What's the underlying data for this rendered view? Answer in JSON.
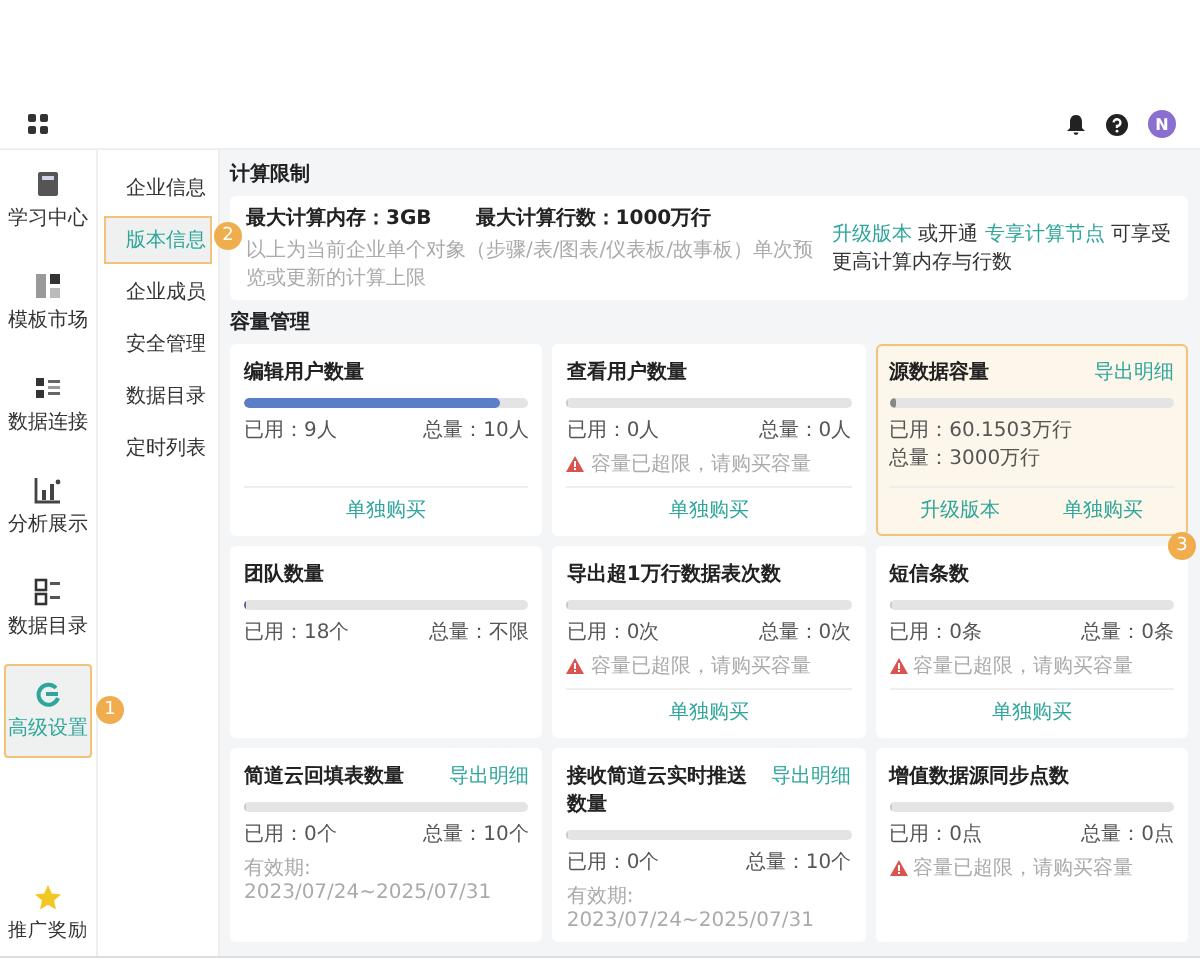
{
  "topbar": {
    "avatar": "N"
  },
  "rail": {
    "items": [
      {
        "label": "学习中心",
        "selected": false,
        "highlighted": false
      },
      {
        "label": "模板市场",
        "selected": false,
        "highlighted": false
      },
      {
        "label": "数据连接",
        "selected": false,
        "highlighted": false
      },
      {
        "label": "分析展示",
        "selected": false,
        "highlighted": false
      },
      {
        "label": "数据目录",
        "selected": false,
        "highlighted": false
      },
      {
        "label": "高级设置",
        "selected": true,
        "highlighted": true,
        "callout": "1"
      }
    ],
    "bottom": {
      "label": "推广奖励"
    }
  },
  "submenu": {
    "items": [
      {
        "label": "企业信息",
        "selected": false,
        "highlighted": false
      },
      {
        "label": "版本信息",
        "selected": true,
        "highlighted": true,
        "callout": "2"
      },
      {
        "label": "企业成员",
        "selected": false,
        "highlighted": false
      },
      {
        "label": "安全管理",
        "selected": false,
        "highlighted": false
      },
      {
        "label": "数据目录",
        "selected": false,
        "highlighted": false
      },
      {
        "label": "定时列表",
        "selected": false,
        "highlighted": false
      }
    ]
  },
  "compute_limits": {
    "title": "计算限制",
    "max_memory": "最大计算内存：3GB",
    "max_rows": "最大计算行数：1000万行",
    "hint": "以上为当前企业单个对象（步骤/表/图表/仪表板/故事板）单次预览或更新的计算上限",
    "upgrade_note": [
      {
        "kind": "link",
        "text": "升级版本"
      },
      {
        "kind": "text",
        "text": "或开通"
      },
      {
        "kind": "link",
        "text": "专享计算节点"
      },
      {
        "kind": "text",
        "text": "可享受更高计算内存与行数"
      }
    ]
  },
  "capacity": {
    "title": "容量管理",
    "cards": [
      {
        "title": "编辑用户数量",
        "level": 0.9,
        "color": "#5b7fc7",
        "used": "已用：9人",
        "total": "总量：10人",
        "actions": [
          "单独购买"
        ],
        "highlighted": false
      },
      {
        "title": "查看用户数量",
        "level": 0,
        "used": "已用：0人",
        "total": "总量：0人",
        "warning": "容量已超限，请购买容量",
        "actions": [
          "单独购买"
        ],
        "highlighted": false
      },
      {
        "title": "源数据容量",
        "export": "导出明细",
        "level": 0.02,
        "color": "#888888",
        "used": "已用：60.1503万行",
        "total": "总量：3000万行",
        "actions": [
          "升级版本",
          "单独购买"
        ],
        "highlighted": true,
        "callout": "3"
      },
      {
        "title": "团队数量",
        "level": 0.01,
        "color": "#6a5a9a",
        "used": "已用：18个",
        "total": "总量：不限",
        "highlighted": false
      },
      {
        "title": "导出超1万行数据表次数",
        "level": 0,
        "used": "已用：0次",
        "total": "总量：0次",
        "warning": "容量已超限，请购买容量",
        "actions": [
          "单独购买"
        ],
        "highlighted": false
      },
      {
        "title": "短信条数",
        "level": 0,
        "used": "已用：0条",
        "total": "总量：0条",
        "warning": "容量已超限，请购买容量",
        "actions": [
          "单独购买"
        ],
        "highlighted": false
      },
      {
        "title": "简道云回填表数量",
        "export": "导出明细",
        "level": 0,
        "used": "已用：0个",
        "total": "总量：10个",
        "validity": "有效期: 2023/07/24~2025/07/31",
        "highlighted": false
      },
      {
        "title": "接收简道云实时推送数量",
        "export": "导出明细",
        "level": 0,
        "used": "已用：0个",
        "total": "总量：10个",
        "validity": "有效期: 2023/07/24~2025/07/31",
        "highlighted": false
      },
      {
        "title": "增值数据源同步点数",
        "level": 0,
        "used": "已用：0点",
        "total": "总量：0点",
        "warning": "容量已超限，请购买容量",
        "highlighted": false
      }
    ]
  }
}
